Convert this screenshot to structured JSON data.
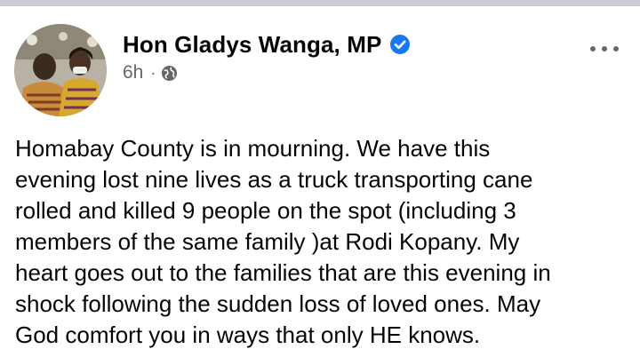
{
  "post": {
    "author": {
      "name": "Hon Gladys Wanga, MP",
      "verified": true
    },
    "meta": {
      "time": "6h",
      "separator": "·",
      "audience_icon": "globe-icon"
    },
    "menu_icon": "more-horizontal-icon",
    "text_lines": [
      "Homabay County is in mourning. We have this",
      "evening lost nine lives as a truck transporting cane",
      "rolled and killed 9 people on the spot (including 3",
      "members of the same family )at Rodi Kopany. My",
      "heart goes out to the families that are this evening in",
      "shock following the sudden loss of loved ones. May",
      "God comfort you in ways that only HE knows."
    ]
  },
  "colors": {
    "verified_badge": "#1877f2",
    "meta_text": "#65676b",
    "body_text": "#050505"
  }
}
